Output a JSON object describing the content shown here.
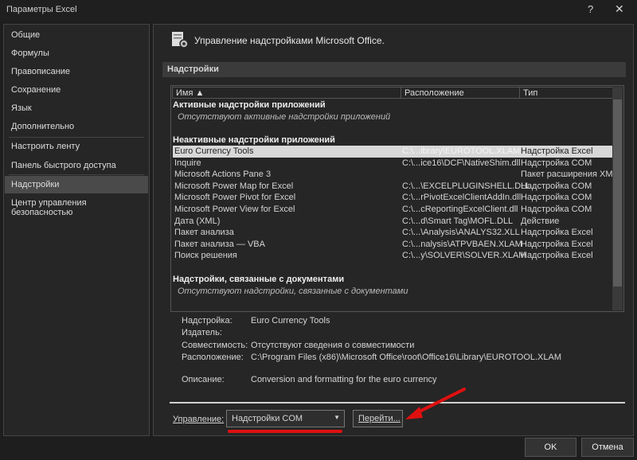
{
  "window": {
    "title": "Параметры Excel",
    "help": "?",
    "close": "✕"
  },
  "sidebar": {
    "items": [
      {
        "label": "Общие"
      },
      {
        "label": "Формулы"
      },
      {
        "label": "Правописание"
      },
      {
        "label": "Сохранение"
      },
      {
        "label": "Язык"
      },
      {
        "label": "Дополнительно"
      },
      {
        "label": "Настроить ленту"
      },
      {
        "label": "Панель быстрого доступа"
      },
      {
        "label": "Надстройки",
        "selected": true
      },
      {
        "label": "Центр управления безопасностью"
      }
    ]
  },
  "main": {
    "header": "Управление надстройками Microsoft Office.",
    "section": "Надстройки",
    "columns": [
      "Имя ▲",
      "Расположение",
      "Тип"
    ],
    "groups": {
      "active": {
        "title": "Активные надстройки приложений",
        "empty": "Отсутствуют активные надстройки приложений"
      },
      "inactive": {
        "title": "Неактивные надстройки приложений"
      },
      "document": {
        "title": "Надстройки, связанные с документами",
        "empty": "Отсутствуют надстройки, связанные с документами"
      }
    },
    "rows": [
      {
        "name": "Euro Currency Tools",
        "location": "C:\\...ibrary\\EUROTOOL.XLAM",
        "type": "Надстройка Excel",
        "selected": true
      },
      {
        "name": "Inquire",
        "location": "C:\\...ice16\\DCF\\NativeShim.dll",
        "type": "Надстройка COM"
      },
      {
        "name": "Microsoft Actions Pane 3",
        "location": "",
        "type": "Пакет расширения XML"
      },
      {
        "name": "Microsoft Power Map for Excel",
        "location": "C:\\...\\EXCELPLUGINSHELL.DLL",
        "type": "Надстройка COM"
      },
      {
        "name": "Microsoft Power Pivot for Excel",
        "location": "C:\\...rPivotExcelClientAddIn.dll",
        "type": "Надстройка COM"
      },
      {
        "name": "Microsoft Power View for Excel",
        "location": "C:\\...cReportingExcelClient.dll",
        "type": "Надстройка COM"
      },
      {
        "name": "Дата (XML)",
        "location": "C:\\...d\\Smart Tag\\MOFL.DLL",
        "type": "Действие"
      },
      {
        "name": "Пакет анализа",
        "location": "C:\\...\\Analysis\\ANALYS32.XLL",
        "type": "Надстройка Excel"
      },
      {
        "name": "Пакет анализа — VBA",
        "location": "C:\\...nalysis\\ATPVBAEN.XLAM",
        "type": "Надстройка Excel"
      },
      {
        "name": "Поиск решения",
        "location": "C:\\...y\\SOLVER\\SOLVER.XLAM",
        "type": "Надстройка Excel"
      }
    ],
    "details": [
      {
        "label": "Надстройка:",
        "value": "Euro Currency Tools"
      },
      {
        "label": "Издатель:",
        "value": ""
      },
      {
        "label": "Совместимость:",
        "value": "Отсутствуют сведения о совместимости"
      },
      {
        "label": "Расположение:",
        "value": "C:\\Program Files (x86)\\Microsoft Office\\root\\Office16\\Library\\EUROTOOL.XLAM"
      },
      {
        "label": "Описание:",
        "value": "Conversion and formatting for the euro currency"
      }
    ],
    "manage": {
      "label": "Управление:",
      "value": "Надстройки COM",
      "go": "Перейти..."
    }
  },
  "footer": {
    "ok": "OK",
    "cancel": "Отмена"
  },
  "colors": {
    "annotation": "#e01010",
    "selected_row": "#d8d8d8"
  }
}
